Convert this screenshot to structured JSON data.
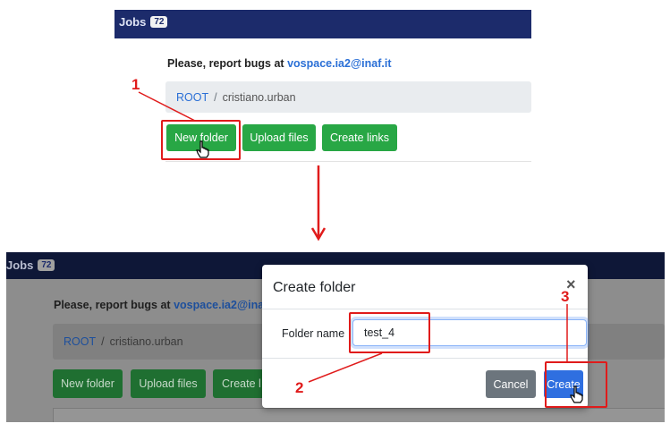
{
  "top": {
    "jobs_label": "Jobs",
    "jobs_count": "72",
    "bugs_text": "Please, report bugs at ",
    "bugs_email": "vospace.ia2@inaf.it",
    "breadcrumb": {
      "root": "ROOT",
      "separator": "/",
      "user": "cristiano.urban"
    },
    "buttons": {
      "new_folder": "New folder",
      "upload_files": "Upload files",
      "create_links": "Create links"
    }
  },
  "bottom": {
    "jobs_label": "Jobs",
    "jobs_count": "72",
    "bugs_text": "Please, report bugs at ",
    "bugs_email": "vospace.ia2@ina",
    "breadcrumb": {
      "root": "ROOT",
      "separator": "/",
      "user": "cristiano.urban"
    },
    "buttons": {
      "new_folder": "New folder",
      "upload_files": "Upload files",
      "create_partial": "Create l"
    },
    "modal": {
      "title": "Create folder",
      "close": "×",
      "field_label": "Folder name",
      "field_value": "test_4",
      "cancel": "Cancel",
      "create": "Create"
    }
  },
  "annotations": {
    "step1": "1",
    "step2": "2",
    "step3": "3"
  },
  "icons": [
    "hand-cursor-icon",
    "down-arrow-icon",
    "close-icon"
  ],
  "colors": {
    "navbar": "#1c2b6b",
    "success": "#28a745",
    "primary": "#2f6fe0",
    "annotation": "#e01b1b"
  }
}
